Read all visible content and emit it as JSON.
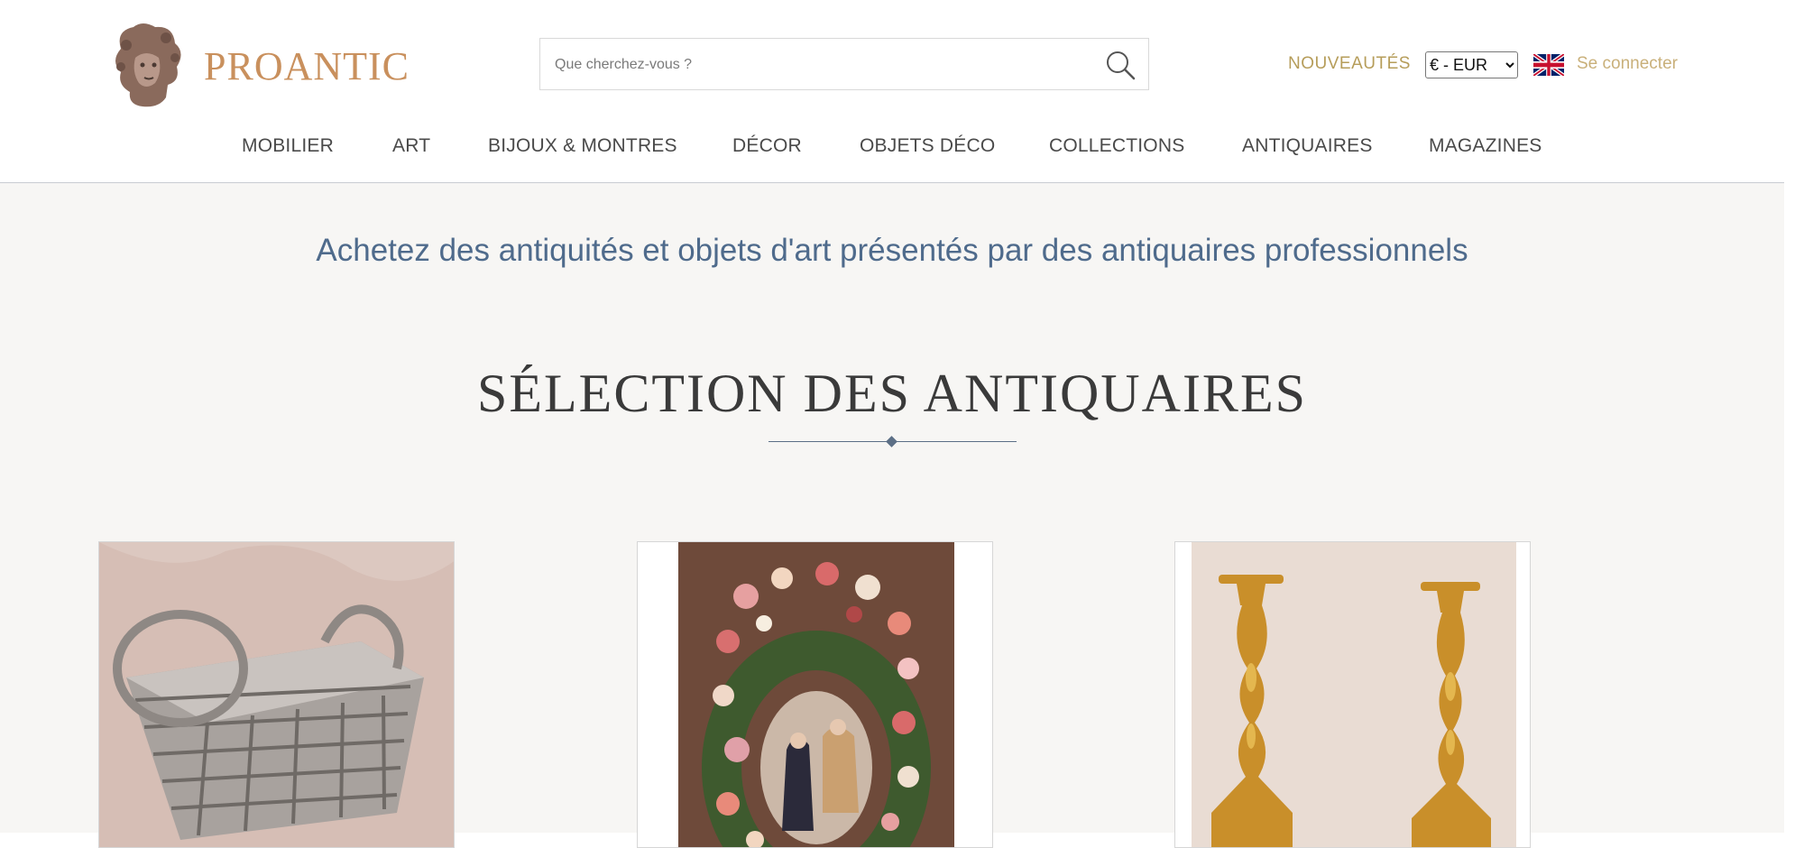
{
  "header": {
    "logo_text": "PROANTIC",
    "search": {
      "placeholder": "Que cherchez-vous ?"
    },
    "new_link": "NOUVEAUTÉS",
    "currency": {
      "selected": "€ - EUR"
    },
    "language_icon": "uk-flag-icon",
    "login_link": "Se connecter"
  },
  "nav": {
    "items": [
      {
        "label": "MOBILIER"
      },
      {
        "label": "ART"
      },
      {
        "label": "BIJOUX & MONTRES"
      },
      {
        "label": "DÉCOR"
      },
      {
        "label": "OBJETS DÉCO"
      },
      {
        "label": "COLLECTIONS"
      },
      {
        "label": "ANTIQUAIRES"
      },
      {
        "label": "MAGAZINES"
      }
    ]
  },
  "hero": {
    "tagline": "Achetez des antiquités et objets d'art présentés par des antiquaires professionnels",
    "section_title": "SÉLECTION DES ANTIQUAIRES"
  },
  "products": [
    {
      "image": "silver-basket"
    },
    {
      "image": "flower-wreath-painting"
    },
    {
      "image": "gilt-bronze-candlesticks"
    }
  ],
  "colors": {
    "brand": "#c9905d",
    "accent_gold": "#b69d5a",
    "tagline_blue": "#4f6b8c",
    "background": "#f7f6f4"
  }
}
